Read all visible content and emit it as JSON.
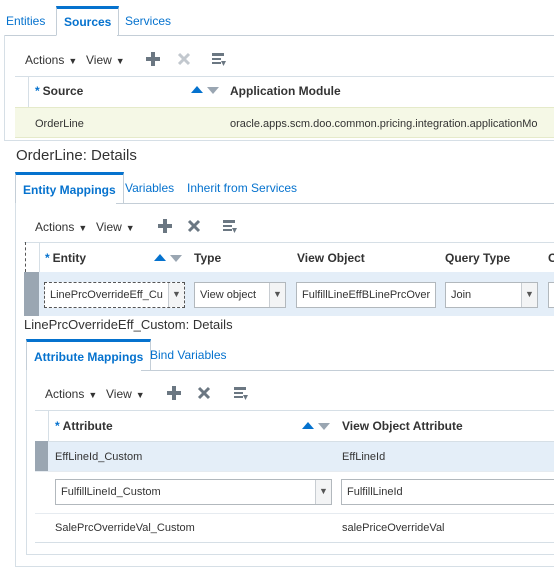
{
  "top_tabs": [
    "Entities",
    "Sources",
    "Services"
  ],
  "toolbar": {
    "actions": "Actions",
    "view": "View"
  },
  "sources_table": {
    "columns": [
      "Source",
      "Application Module"
    ],
    "rows": [
      {
        "source": "OrderLine",
        "module": "oracle.apps.scm.doo.common.pricing.integration.applicationMo"
      }
    ]
  },
  "details_title": "OrderLine: Details",
  "detail_tabs": [
    "Entity Mappings",
    "Variables",
    "Inherit from Services"
  ],
  "entity_table": {
    "columns": [
      "Entity",
      "Type",
      "View Object",
      "Query Type",
      "C"
    ],
    "row": {
      "entity": "LinePrcOverrideEff_Cu",
      "type": "View object",
      "view_object": "FulfillLineEffBLinePrcOver",
      "query_type": "Join"
    }
  },
  "entity_details_title": "LinePrcOverrideEff_Custom: Details",
  "attr_tabs": [
    "Attribute Mappings",
    "Bind Variables"
  ],
  "attr_table": {
    "columns": [
      "Attribute",
      "View Object Attribute"
    ],
    "rows": [
      {
        "attribute": "EffLineId_Custom",
        "vo_attribute": "EffLineId"
      },
      {
        "attribute": "FulfillLineId_Custom",
        "vo_attribute": "FulfillLineId"
      },
      {
        "attribute": "SalePrcOverrideVal_Custom",
        "vo_attribute": "salePriceOverrideVal"
      }
    ]
  },
  "colors": {
    "accent": "#0572ce",
    "selected_row": "#f5f8e6",
    "hover_row": "#e4eef8"
  }
}
